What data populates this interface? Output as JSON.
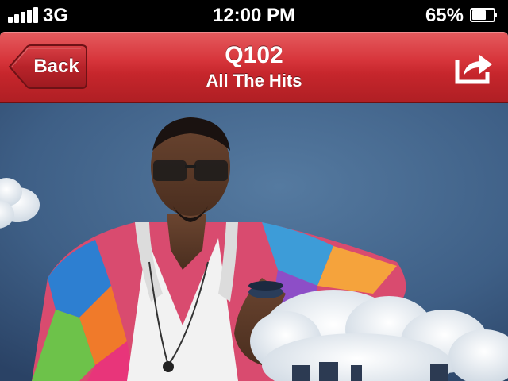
{
  "status_bar": {
    "network": "3G",
    "time": "12:00 PM",
    "battery_percent": "65%",
    "battery_level": 0.65,
    "signal_bars": 5
  },
  "nav": {
    "back_label": "Back",
    "title": "Q102",
    "subtitle": "All The Hits",
    "share_icon": "share-icon",
    "accent_color": "#c6262c"
  },
  "artwork": {
    "background_color": "#3e5f86",
    "icon": "album-art"
  }
}
